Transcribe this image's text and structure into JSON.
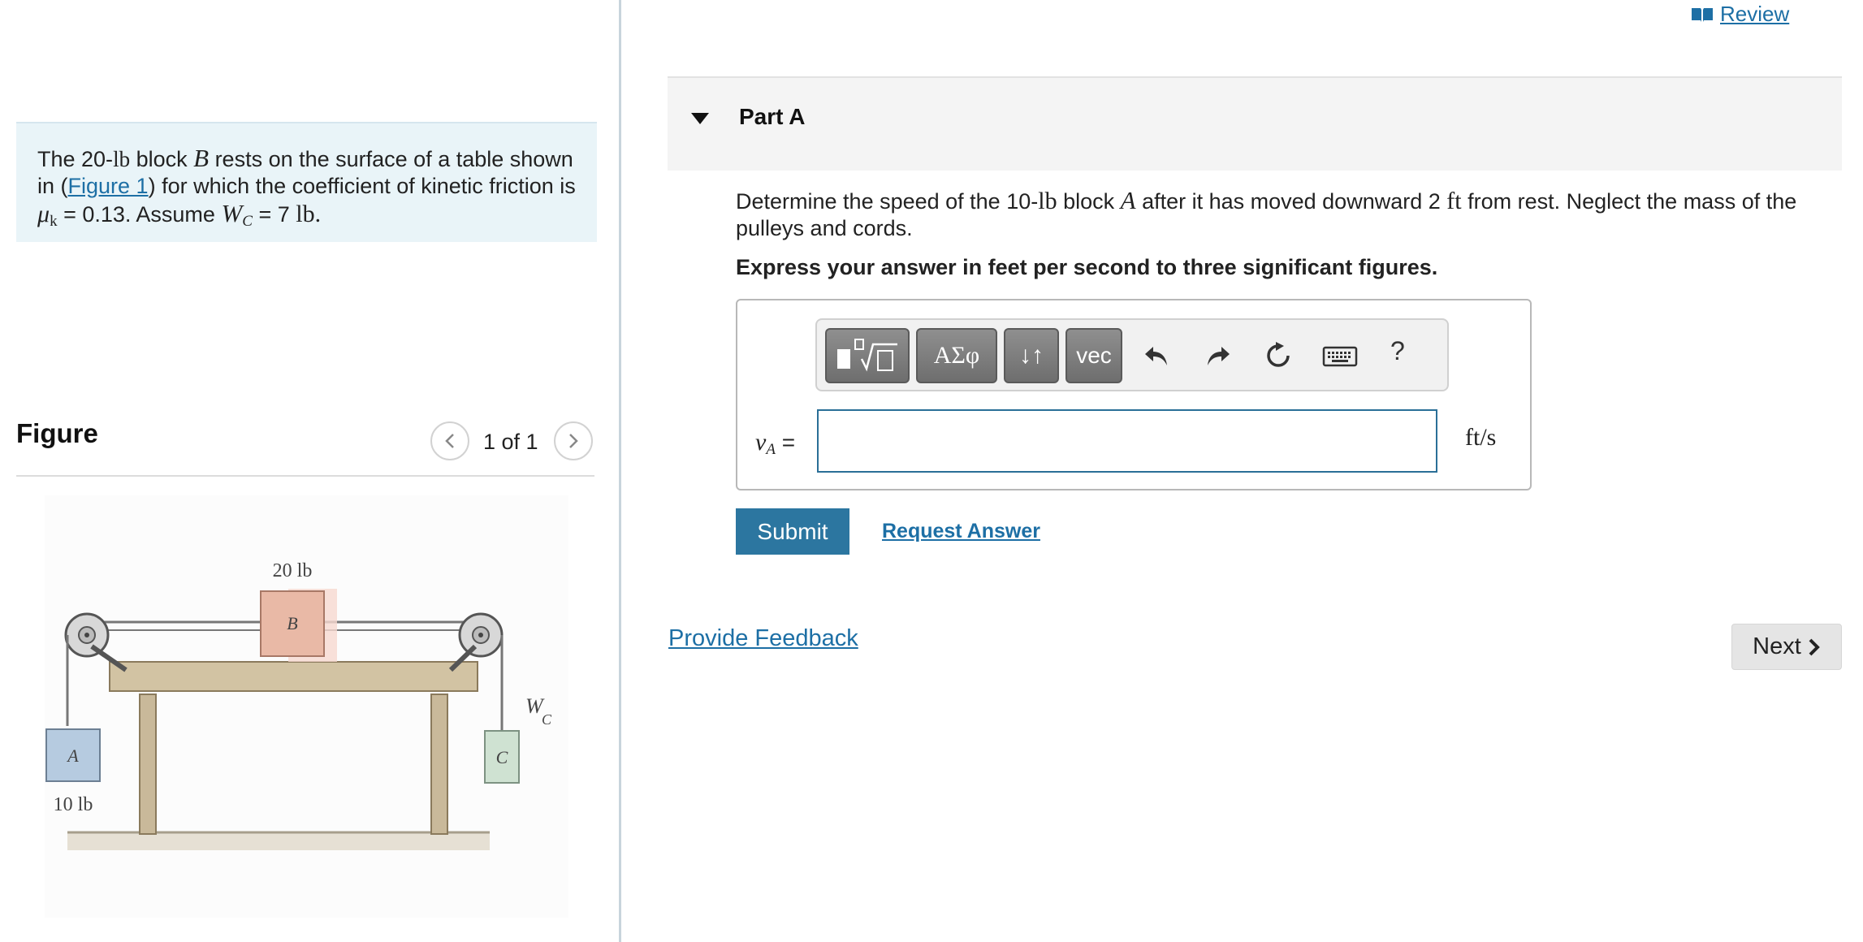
{
  "header": {
    "review_label": "Review"
  },
  "problem": {
    "intro": "The 20-",
    "unit_lb": "lb",
    "block_text": " block ",
    "block_var": "B",
    "rest_text": " rests on the surface of a table shown",
    "line2_pre": "in (",
    "figure_link": "Figure 1",
    "line2_post": ") for which the coefficient of kinetic friction is",
    "mu": "μ",
    "mu_sub": "k",
    "mu_value": " = 0.13. Assume ",
    "w_var": "W",
    "w_sub": "C",
    "w_value": " = 7 ",
    "w_unit": "lb."
  },
  "figure": {
    "title": "Figure",
    "pager": "1 of 1",
    "label_b_weight": "20 lb",
    "label_b": "B",
    "label_a": "A",
    "label_a_weight": "10 lb",
    "label_c": "C",
    "label_wc": "W",
    "label_wc_sub": "C"
  },
  "part": {
    "title": "Part A"
  },
  "question": {
    "pre": "Determine the speed of the 10-",
    "unit_lb": "lb",
    "mid": " block ",
    "var_a": "A",
    "post": " after it has moved downward 2 ",
    "unit_ft": "ft",
    "end": " from rest. Neglect the mass of the pulleys and cords.",
    "instruction": "Express your answer in feet per second to three significant figures."
  },
  "toolbar": {
    "greek_label": "ΑΣφ",
    "arrows_label": "↓↑",
    "vec_label": "vec",
    "help_label": "?"
  },
  "answer": {
    "var": "v",
    "var_sub": "A",
    "equals": " =",
    "value": "",
    "unit": "ft/s"
  },
  "actions": {
    "submit": "Submit",
    "request": "Request Answer",
    "feedback": "Provide Feedback",
    "next": "Next"
  },
  "colors": {
    "accent": "#2c76a0",
    "link": "#1d6fa5",
    "problem_bg": "#e9f4f8"
  }
}
